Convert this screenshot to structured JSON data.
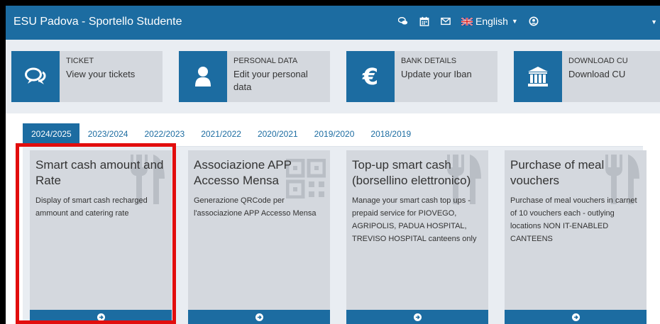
{
  "navbar": {
    "brand": "ESU Padova - Sportello Studente",
    "language": "English",
    "icons": [
      "chat-icon",
      "calendar-icon",
      "mail-icon",
      "flag-icon",
      "user-icon"
    ]
  },
  "quick_links": [
    {
      "title": "TICKET",
      "desc": "View your tickets",
      "icon": "chat-bubbles-icon"
    },
    {
      "title": "PERSONAL DATA",
      "desc": "Edit your personal data",
      "icon": "user-icon"
    },
    {
      "title": "BANK DETAILS",
      "desc": "Update your Iban",
      "icon": "euro-icon"
    },
    {
      "title": "DOWNLOAD CU",
      "desc": "Download CU",
      "icon": "bank-icon"
    }
  ],
  "tabs": [
    "2024/2025",
    "2023/2024",
    "2022/2023",
    "2021/2022",
    "2020/2021",
    "2019/2020",
    "2018/2019"
  ],
  "active_tab": "2024/2025",
  "cards": [
    {
      "title": "Smart cash amount and Rate",
      "desc": "Display of smart cash recharged ammount and catering rate",
      "watermark": "fork-knife-icon"
    },
    {
      "title": "Associazione APP Accesso Mensa",
      "desc": "Generazione QRCode per l'associazione APP Accesso Mensa",
      "watermark": "qr-code-icon"
    },
    {
      "title": "Top-up smart cash (borsellino elettronico)",
      "desc": "Manage your smart cash top ups - prepaid service for PIOVEGO, AGRIPOLIS, PADUA HOSPITAL, TREVISO HOSPITAL canteens only",
      "watermark": "fork-knife-icon"
    },
    {
      "title": "Purchase of meal vouchers",
      "desc": "Purchase of meal vouchers in carnet of 10 vouchers each - outlying locations NON IT-ENABLED CANTEENS",
      "watermark": "fork-knife-icon"
    }
  ],
  "colors": {
    "primary": "#1c6ca1",
    "card_bg": "#d4d8de",
    "panel_bg": "#e9edf2",
    "highlight": "#e20d0d"
  }
}
